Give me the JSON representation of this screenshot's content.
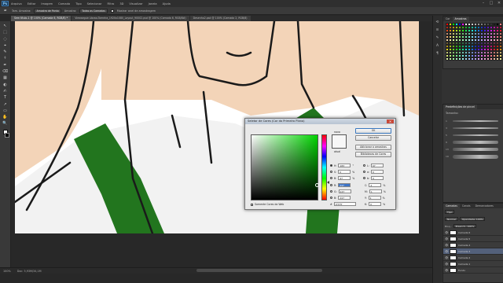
{
  "menu": {
    "logo": "Ps",
    "items": [
      "Arquivo",
      "Editar",
      "Imagem",
      "Camada",
      "Tipo",
      "Selecionar",
      "Filtro",
      "3D",
      "Visualizar",
      "Janela",
      "Ajuda"
    ],
    "window_controls": [
      "–",
      "□",
      "✕"
    ]
  },
  "options": {
    "size_label": "Tam. Amostra:",
    "size_value": "Amostra de Ponto",
    "sample_label": "Amostra:",
    "sample_value": "Todas as Camadas",
    "show_ring_label": "Mostrar anel de amostragem"
  },
  "tabs": [
    {
      "label": "Sem título-1 @ 100% (Camada 6, RGB/8) *",
      "active": true
    },
    {
      "label": "Viewseguin-Vazao-Tomeira_1920x1080_Layout_90002.psd @ 100% (Camada 6, RGB/8#)",
      "active": false
    },
    {
      "label": "Desenho2.psd @ 100% (Camada 2, RGB/8)",
      "active": false
    }
  ],
  "tools": [
    "↖",
    "⬚",
    "◌",
    "⌖",
    "✎",
    "⚕",
    "✒",
    "⌫",
    "▦",
    "◐",
    "✍",
    "T",
    "↗",
    "▭",
    "✋",
    "🔍"
  ],
  "status": {
    "zoom": "100%",
    "doc": "Doc: 5,93M/34,1M"
  },
  "dialog": {
    "title": "Seletor de Cores (Cor do Primeiro Plano)",
    "close": "✕",
    "new_label": "novo",
    "current_label": "atual",
    "ok": "OK",
    "cancel": "Cancelar",
    "add_swatch": "Adicionar a amostras",
    "libraries": "Bibliotecas de Cores",
    "only_web": "Somente Cores da Web",
    "hsb": {
      "h": "183",
      "h_unit": "°",
      "s": "0",
      "s_unit": "%",
      "b": "97",
      "b_unit": "%"
    },
    "rgb": {
      "r": "247",
      "g": "247",
      "b": "247"
    },
    "lab": {
      "l": "97",
      "a": "0",
      "b": "0"
    },
    "cmyk": {
      "c": "2",
      "c_unit": "%",
      "m": "1",
      "m_unit": "%",
      "y": "1",
      "y_unit": "%",
      "k": "0",
      "k_unit": "%"
    },
    "hex": "f7f7f7",
    "hex_label": "#"
  },
  "panels": {
    "color_tabs": [
      "Cor",
      "Amostras"
    ],
    "brush_tabs": [
      "Predefinições de pincel"
    ],
    "brush_search": "Tamanho:",
    "brush_sizes": [
      "1",
      "3",
      "5",
      "9",
      "13",
      "19"
    ],
    "layers_tabs": [
      "Camadas",
      "Canais",
      "Demarcadores"
    ],
    "layer_kind": "Tipo",
    "blend_mode": "Normal",
    "opacity": "Opacidade: 100%",
    "lock": "Bloq.:",
    "fill": "Preench.: 100%",
    "layers": [
      {
        "name": "Camada 6",
        "selected": false
      },
      {
        "name": "Camada 5",
        "selected": false
      },
      {
        "name": "Camada 4",
        "selected": false
      },
      {
        "name": "Camada 3",
        "selected": true
      },
      {
        "name": "Camada 2",
        "selected": false
      },
      {
        "name": "Camada 1",
        "selected": false
      },
      {
        "name": "Fundo",
        "selected": false
      }
    ]
  },
  "colors": {
    "skin": "#f3d4b8",
    "green": "#22751e",
    "shirt": "#f2f2f2",
    "outline": "#1a1a1a"
  }
}
